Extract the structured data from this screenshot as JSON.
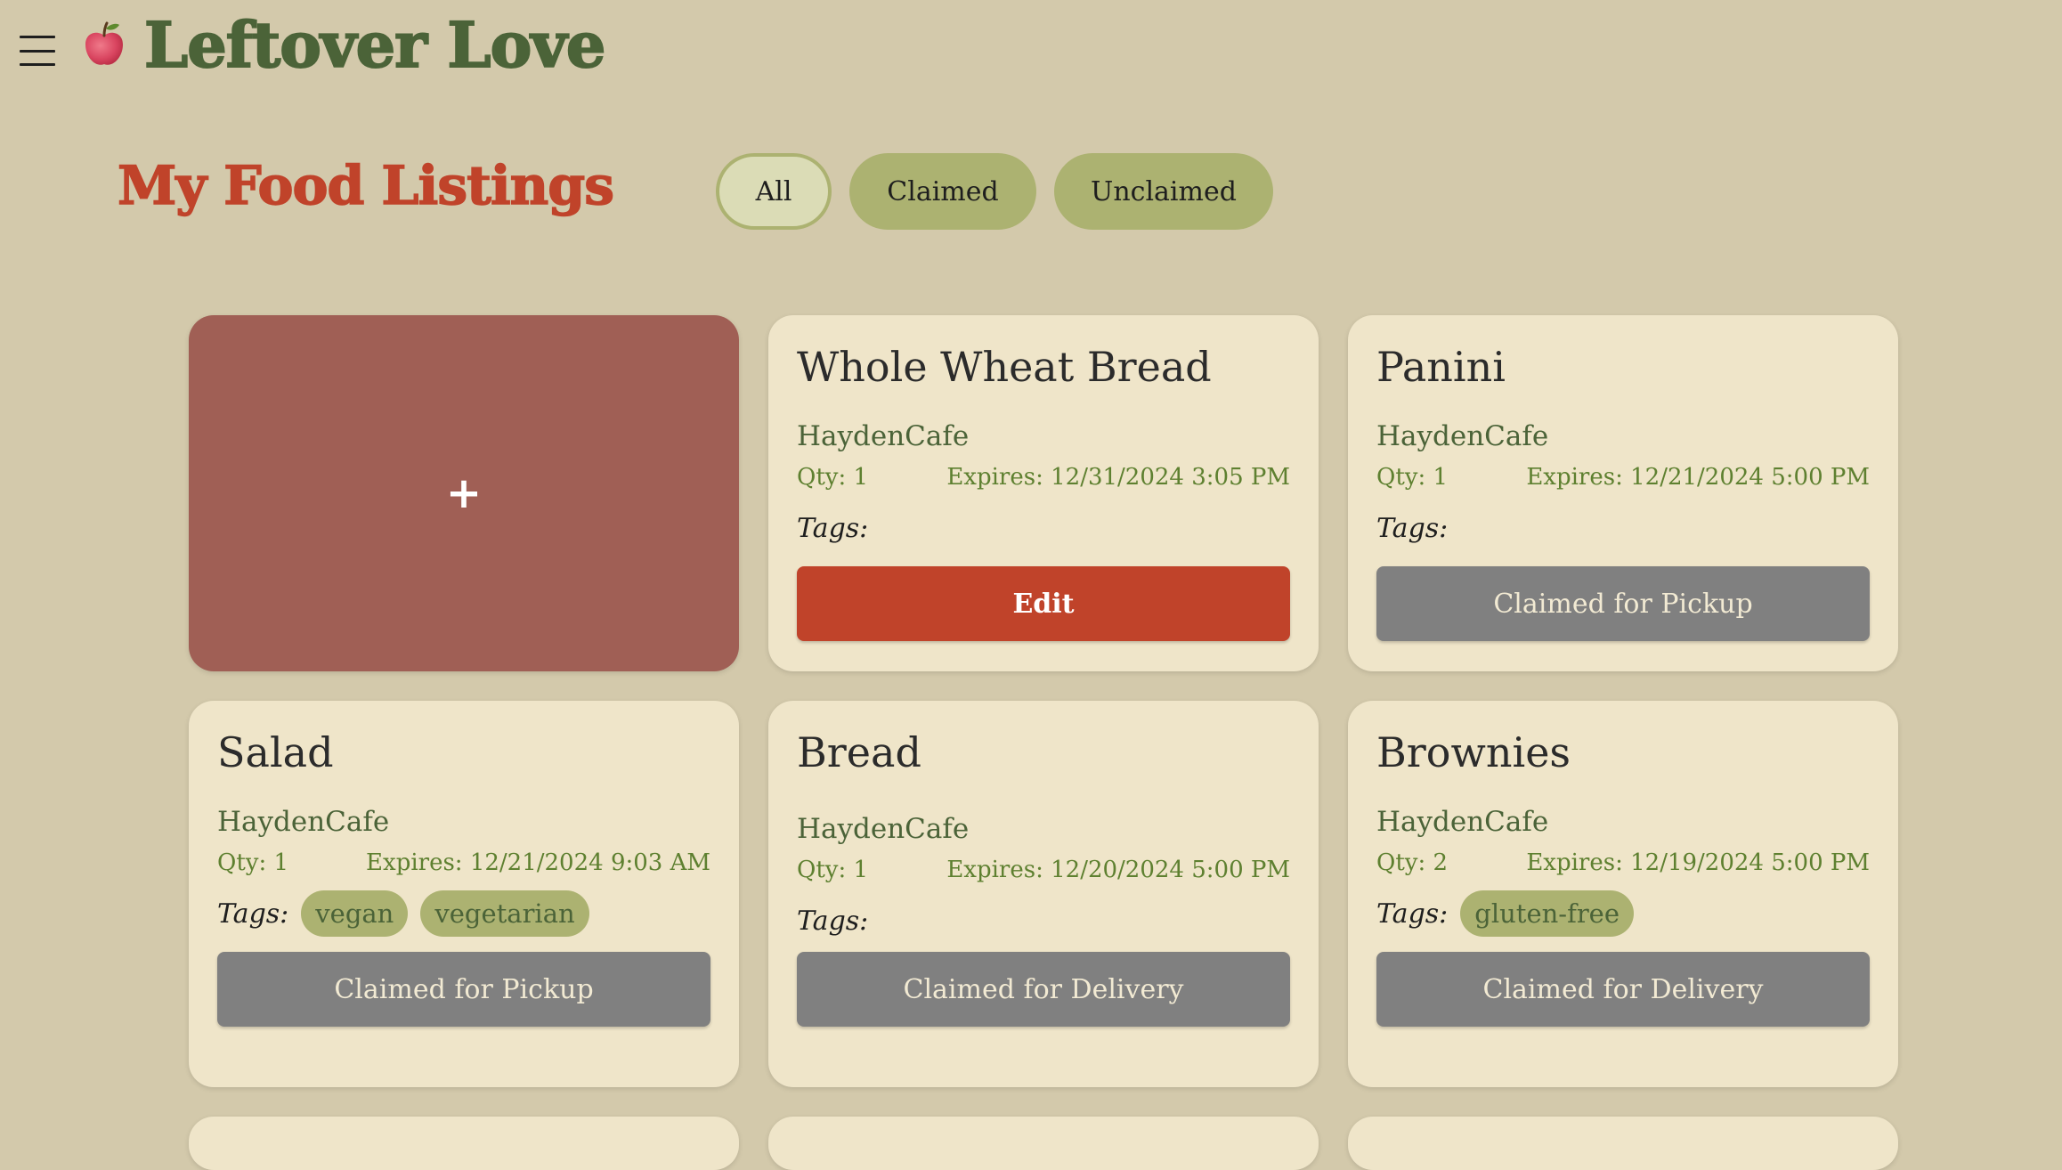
{
  "app": {
    "title": "Leftover Love",
    "logo_icon": "apple-icon",
    "menu_icon": "hamburger-menu-icon"
  },
  "page": {
    "title": "My Food Listings"
  },
  "filters": [
    {
      "label": "All",
      "active": true
    },
    {
      "label": "Claimed",
      "active": false
    },
    {
      "label": "Unclaimed",
      "active": false
    }
  ],
  "add_card": {
    "label": "+"
  },
  "listings": [
    {
      "title": "Whole Wheat Bread",
      "vendor": "HaydenCafe",
      "qty": "Qty: 1",
      "expires": "Expires: 12/31/2024 3:05 PM",
      "tags_label": "Tags:",
      "tags": [],
      "action": "Edit",
      "action_type": "edit"
    },
    {
      "title": "Panini",
      "vendor": "HaydenCafe",
      "qty": "Qty: 1",
      "expires": "Expires: 12/21/2024 5:00 PM",
      "tags_label": "Tags:",
      "tags": [],
      "action": "Claimed for Pickup",
      "action_type": "claimed"
    },
    {
      "title": "Salad",
      "vendor": "HaydenCafe",
      "qty": "Qty: 1",
      "expires": "Expires: 12/21/2024 9:03 AM",
      "tags_label": "Tags:",
      "tags": [
        "vegan",
        "vegetarian"
      ],
      "action": "Claimed for Pickup",
      "action_type": "claimed"
    },
    {
      "title": "Bread",
      "vendor": "HaydenCafe",
      "qty": "Qty: 1",
      "expires": "Expires: 12/20/2024 5:00 PM",
      "tags_label": "Tags:",
      "tags": [],
      "action": "Claimed for Delivery",
      "action_type": "claimed"
    },
    {
      "title": "Brownies",
      "vendor": "HaydenCafe",
      "qty": "Qty: 2",
      "expires": "Expires: 12/19/2024 5:00 PM",
      "tags_label": "Tags:",
      "tags": [
        "gluten-free"
      ],
      "action": "Claimed for Delivery",
      "action_type": "claimed"
    }
  ],
  "colors": {
    "background": "#d3c9ab",
    "card": "#efe5c9",
    "brand_green": "#4b6338",
    "accent_red": "#c0432a",
    "add_card": "#a05f55",
    "pill_green": "#acb271",
    "claimed_gray": "#808080"
  }
}
